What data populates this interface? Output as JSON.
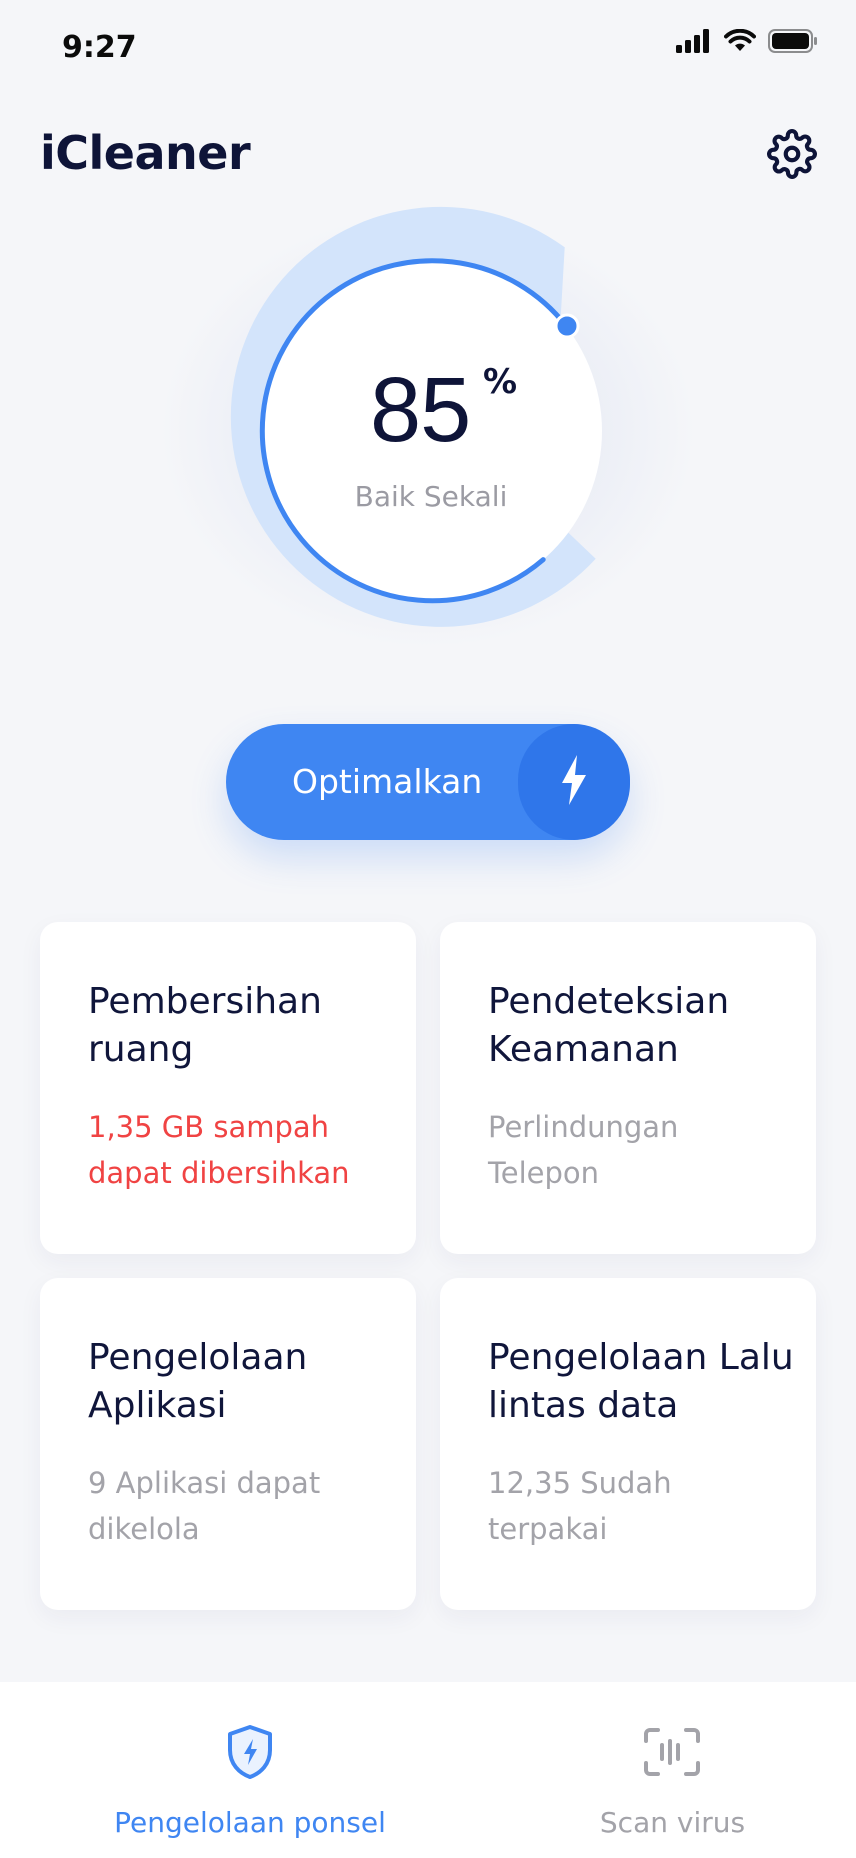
{
  "status_bar": {
    "time": "9:27"
  },
  "header": {
    "title": "iCleaner"
  },
  "gauge": {
    "score": "85",
    "unit": "%",
    "label": "Baik Sekali",
    "progress": 0.85
  },
  "optimize_button": {
    "label": "Optimalkan"
  },
  "cards": [
    {
      "title": "Pembersihan ruang",
      "subtitle": "1,35 GB sampah dapat dibersihkan"
    },
    {
      "title": "Pendeteksian Keamanan",
      "subtitle": "Perlindungan Telepon"
    },
    {
      "title": "Pengelolaan Aplikasi",
      "subtitle": "9 Aplikasi dapat dikelola"
    },
    {
      "title": "Pengelolaan Lalu lintas data",
      "subtitle": "12,35 Sudah terpakai"
    }
  ],
  "bottom_nav": {
    "items": [
      {
        "label": "Pengelolaan ponsel",
        "icon": "shield-bolt-icon",
        "active": true
      },
      {
        "label": "Scan virus",
        "icon": "scan-icon",
        "active": false
      }
    ]
  },
  "colors": {
    "accent": "#3f86f2",
    "accent_dark": "#2f76ea",
    "ring_light": "#d3e4fb",
    "alert": "#f04343",
    "muted": "#a3a3a9",
    "title": "#0e1438"
  }
}
